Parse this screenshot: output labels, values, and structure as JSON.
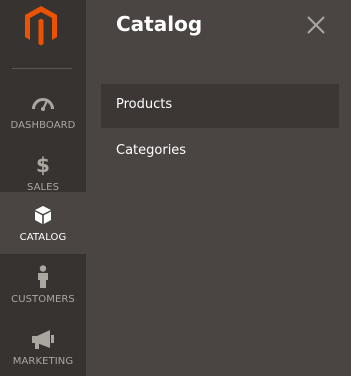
{
  "sidebar": {
    "items": [
      {
        "label": "DASHBOARD",
        "icon": "dashboard-speedometer-icon"
      },
      {
        "label": "SALES",
        "icon": "dollar-sign-icon"
      },
      {
        "label": "CATALOG",
        "icon": "cube-box-icon",
        "active": true
      },
      {
        "label": "CUSTOMERS",
        "icon": "person-icon"
      },
      {
        "label": "MARKETING",
        "icon": "megaphone-icon"
      }
    ]
  },
  "panel": {
    "title": "Catalog",
    "close_icon": "close-icon",
    "items": [
      {
        "label": "Products",
        "highlighted": true
      },
      {
        "label": "Categories"
      }
    ]
  },
  "colors": {
    "sidebar_bg": "#373330",
    "panel_bg": "#4a4542",
    "logo_orange": "#eb5202",
    "nav_text": "#aaa6a0",
    "active_text": "#ffffff"
  }
}
